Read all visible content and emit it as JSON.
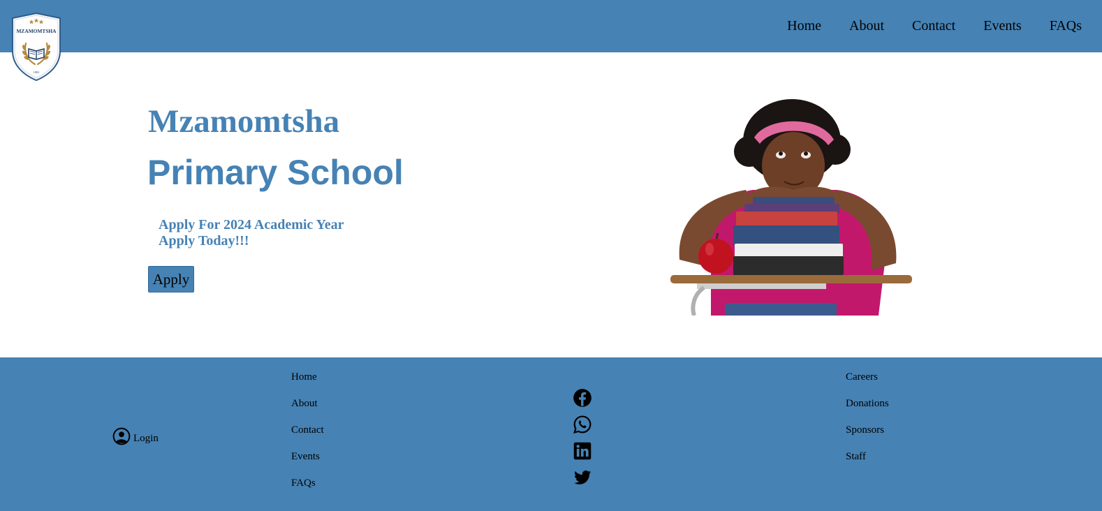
{
  "header": {
    "logo": {
      "name": "MZAMOMTSHA",
      "year": "1981"
    },
    "nav": [
      {
        "label": "Home"
      },
      {
        "label": "About"
      },
      {
        "label": "Contact"
      },
      {
        "label": "Events"
      },
      {
        "label": "FAQs"
      }
    ]
  },
  "hero": {
    "title_line1": "Mzamomtsha",
    "title_line2": "Primary School",
    "subtitle_line1": "Apply For 2024 Academic Year",
    "subtitle_line2": "Apply Today!!!",
    "apply_label": "Apply"
  },
  "footer": {
    "login_label": "Login",
    "links_col1": [
      {
        "label": "Home"
      },
      {
        "label": "About"
      },
      {
        "label": "Contact"
      },
      {
        "label": "Events"
      },
      {
        "label": "FAQs"
      }
    ],
    "social_icons": [
      "facebook-icon",
      "whatsapp-icon",
      "linkedin-icon",
      "twitter-icon"
    ],
    "links_col3": [
      {
        "label": "Careers"
      },
      {
        "label": "Donations"
      },
      {
        "label": "Sponsors"
      },
      {
        "label": "Staff"
      }
    ]
  },
  "colors": {
    "brand": "#4682b4",
    "background": "#ffffff",
    "text": "#000000"
  }
}
